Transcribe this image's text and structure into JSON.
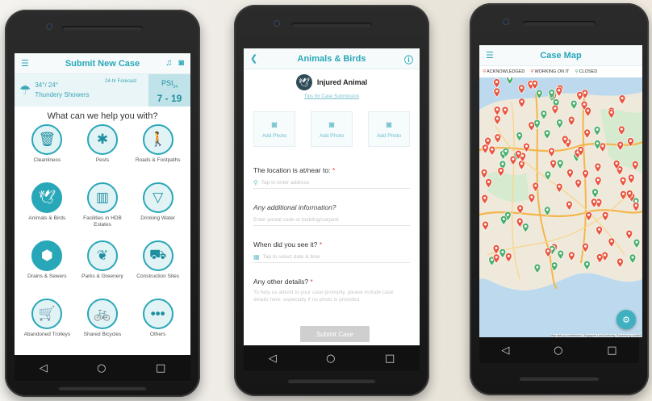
{
  "phone1": {
    "title": "Submit New Case",
    "weather": {
      "temp": "34°/ 24°",
      "desc": "Thundery Showers",
      "forecast": "24-hr Forecast",
      "psi_label": "PSI",
      "psi_sub": "24",
      "psi_value": "7 - 19"
    },
    "help_title": "What can we help you with?",
    "categories": [
      {
        "label": "Cleanliness",
        "icon": "trash-icon"
      },
      {
        "label": "Pests",
        "icon": "mosquito-icon"
      },
      {
        "label": "Roads & Footpaths",
        "icon": "pedestrian-icon"
      },
      {
        "label": "Animals & Birds",
        "icon": "bird-icon"
      },
      {
        "label": "Facilities in HDB Estates",
        "icon": "building-icon"
      },
      {
        "label": "Drinking Water",
        "icon": "glass-icon"
      },
      {
        "label": "Drains & Sewers",
        "icon": "drain-icon"
      },
      {
        "label": "Parks & Greenery",
        "icon": "leaf-icon"
      },
      {
        "label": "Construction Sites",
        "icon": "bulldozer-icon"
      },
      {
        "label": "Abandoned Trolleys",
        "icon": "trolley-icon"
      },
      {
        "label": "Shared Bicycles",
        "icon": "bicycle-icon"
      },
      {
        "label": "Others",
        "icon": "more-icon"
      }
    ]
  },
  "phone2": {
    "title": "Animals & Birds",
    "animal_label": "Injured Animal",
    "tips_link": "Tips for Case Submission",
    "add_photo": "Add Photo",
    "location_label": "The location is at/near to:",
    "location_placeholder": "Tap to enter address",
    "info_label": "Any additional information?",
    "info_placeholder": "Enter postal code or building/carpark",
    "when_label": "When did you see it?",
    "when_placeholder": "Tap to select date & time",
    "details_label": "Any other details?",
    "details_placeholder": "To help us attend to your case promptly, please include case details here, especially if no photo is provided.",
    "submit_label": "Submit Case"
  },
  "phone3": {
    "title": "Case Map",
    "legend": [
      "ACKNOWLEDGED",
      "WORKING ON IT",
      "CLOSED"
    ],
    "attribution": "Map data (c) contributors, Singapore Land Authority. Powered by Leaflet"
  },
  "nav": {
    "back": "◁",
    "home": "○",
    "recent": "□"
  },
  "colors": {
    "teal": "#28a7b8",
    "red_pin": "#e8553d",
    "green_pin": "#4caf6b",
    "map_land": "#efe9dc",
    "map_water": "#bcd9ee"
  }
}
